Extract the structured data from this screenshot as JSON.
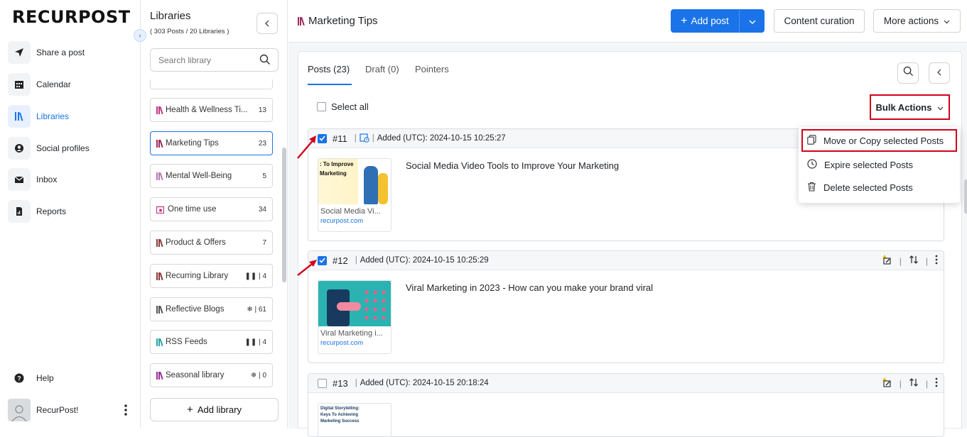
{
  "brand": {
    "logo_text": "RECURPOST",
    "accent": "#1a73e8",
    "highlight": "#d0021b"
  },
  "nav": {
    "items": [
      {
        "label": "Share a post",
        "icon": "send-icon"
      },
      {
        "label": "Calendar",
        "icon": "calendar-icon"
      },
      {
        "label": "Libraries",
        "icon": "library-icon",
        "active": true
      },
      {
        "label": "Social profiles",
        "icon": "user-icon"
      },
      {
        "label": "Inbox",
        "icon": "inbox-icon"
      },
      {
        "label": "Reports",
        "icon": "report-icon"
      }
    ],
    "help": "Help",
    "user": "RecurPost!"
  },
  "libraries": {
    "title": "Libraries",
    "subtitle": "( 303 Posts / 20 Libraries )",
    "search_placeholder": "Search library",
    "items": [
      {
        "name": "Health & Wellness Ti...",
        "count": "13",
        "color": "#c13584"
      },
      {
        "name": "Marketing Tips",
        "count": "23",
        "color": "#9b2c5a",
        "selected": true
      },
      {
        "name": "Mental Well-Being",
        "count": "5",
        "color": "#b77ab5"
      },
      {
        "name": "One time use",
        "count": "34",
        "color": "#c13584"
      },
      {
        "name": "Product & Offers",
        "count": "7",
        "color": "#8a3b3b"
      },
      {
        "name": "Recurring Library",
        "count": "4",
        "prefix": "pause",
        "color": "#8a3b3b"
      },
      {
        "name": "Reflective Blogs",
        "count": "61",
        "prefix": "snow",
        "color": "#555555"
      },
      {
        "name": "RSS Feeds",
        "count": "4",
        "prefix": "pause",
        "color": "#2aa6a6"
      },
      {
        "name": "Seasonal library",
        "count": "0",
        "prefix": "snow",
        "color": "#9b2c9b"
      }
    ],
    "add_label": "Add library"
  },
  "header": {
    "title": "Marketing Tips",
    "add_post": "Add post",
    "content_curation": "Content curation",
    "more_actions": "More actions"
  },
  "tabs": [
    {
      "label": "Posts (23)",
      "active": true
    },
    {
      "label": "Draft (0)"
    },
    {
      "label": "Pointers"
    }
  ],
  "select_all": "Select all",
  "bulk_actions": "Bulk Actions",
  "bulk_menu": [
    {
      "label": "Move or Copy selected Posts",
      "icon": "copy-icon"
    },
    {
      "label": "Expire selected Posts",
      "icon": "clock-icon"
    },
    {
      "label": "Delete selected Posts",
      "icon": "trash-icon"
    }
  ],
  "posts": [
    {
      "num": "#11",
      "checked": true,
      "added": "Added (UTC): 2024-10-15 10:25:27",
      "text": "Social Media Video Tools to Improve Your Marketing",
      "thumb_caption": "Social Media Vi...",
      "domain": "recurpost.com",
      "thumb_title": ": To Improve Marketing"
    },
    {
      "num": "#12",
      "checked": true,
      "added": "Added (UTC): 2024-10-15 10:25:29",
      "text": "Viral Marketing in 2023 - How can you make your brand viral",
      "thumb_caption": "Viral Marketing i...",
      "domain": "recurpost.com"
    },
    {
      "num": "#13",
      "checked": false,
      "added": "Added (UTC): 2024-10-15 20:18:24",
      "text": "",
      "thumb_title": "Digital Storytelling: Keys To Achieving Marketing Success"
    }
  ]
}
